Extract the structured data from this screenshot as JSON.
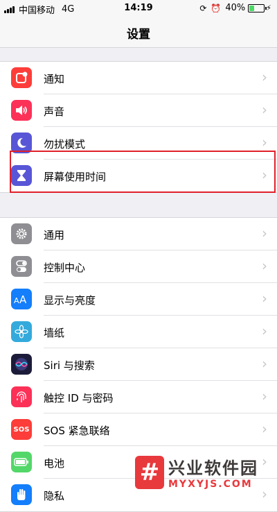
{
  "status_bar": {
    "carrier": "中国移动",
    "network": "4G",
    "time": "14:19",
    "battery_percent": "40%",
    "battery_level": 0.4
  },
  "nav": {
    "title": "设置"
  },
  "groups": [
    {
      "items": [
        {
          "label": "通知",
          "icon": "notification-icon",
          "color": "#fc3d39"
        },
        {
          "label": "声音",
          "icon": "speaker-icon",
          "color": "#fc3158"
        },
        {
          "label": "勿扰模式",
          "icon": "moon-icon",
          "color": "#5856d6"
        },
        {
          "label": "屏幕使用时间",
          "icon": "hourglass-icon",
          "color": "#5856d6"
        }
      ]
    },
    {
      "items": [
        {
          "label": "通用",
          "icon": "gear-icon",
          "color": "#8e8e93"
        },
        {
          "label": "控制中心",
          "icon": "toggle-switches-icon",
          "color": "#8e8e93"
        },
        {
          "label": "显示与亮度",
          "icon": "text-size-icon",
          "color": "#147efb"
        },
        {
          "label": "墙纸",
          "icon": "flower-icon",
          "color": "#34aadc"
        },
        {
          "label": "Siri 与搜索",
          "icon": "siri-icon",
          "color": "#1c1c3a"
        },
        {
          "label": "触控 ID 与密码",
          "icon": "fingerprint-icon",
          "color": "#fc3158"
        },
        {
          "label": "SOS 紧急联络",
          "icon": "sos-icon",
          "color": "#fc3d39"
        },
        {
          "label": "电池",
          "icon": "battery-icon",
          "color": "#53d769"
        },
        {
          "label": "隐私",
          "icon": "hand-icon",
          "color": "#147efb"
        }
      ]
    }
  ],
  "watermark": {
    "symbol": "#",
    "cn": "兴业软件园",
    "en": "MYXYJS.COM"
  }
}
